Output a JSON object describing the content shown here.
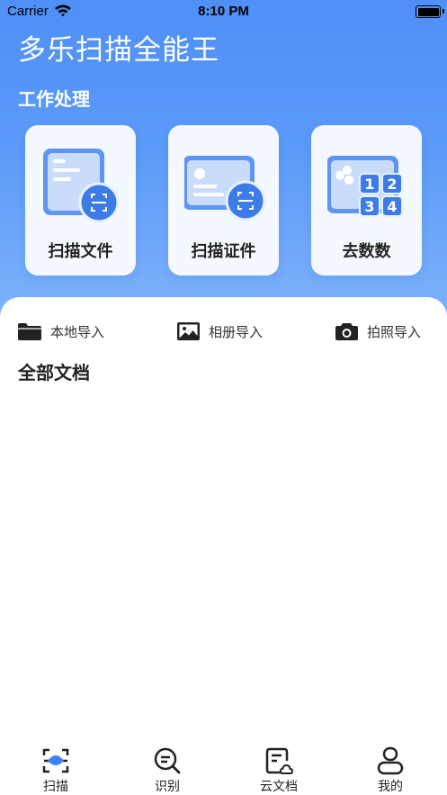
{
  "status_bar": {
    "carrier": "Carrier",
    "time": "8:10 PM"
  },
  "app": {
    "title": "多乐扫描全能王"
  },
  "work": {
    "title": "工作处理",
    "cards": [
      {
        "label": "扫描文件",
        "icon": "scan-document-icon"
      },
      {
        "label": "扫描证件",
        "icon": "scan-id-card-icon"
      },
      {
        "label": "去数数",
        "icon": "count-numbers-icon"
      }
    ]
  },
  "imports": [
    {
      "label": "本地导入",
      "icon": "folder-icon"
    },
    {
      "label": "相册导入",
      "icon": "image-icon"
    },
    {
      "label": "拍照导入",
      "icon": "camera-icon"
    }
  ],
  "documents": {
    "title": "全部文档"
  },
  "tabbar": [
    {
      "label": "扫描",
      "icon": "scan-tab-icon"
    },
    {
      "label": "识别",
      "icon": "recognize-search-icon"
    },
    {
      "label": "云文档",
      "icon": "cloud-document-icon"
    },
    {
      "label": "我的",
      "icon": "user-profile-icon"
    }
  ],
  "colors": {
    "primary": "#4f8ff7",
    "accent": "#3d7be6",
    "active_tab": "#3c82f6"
  }
}
